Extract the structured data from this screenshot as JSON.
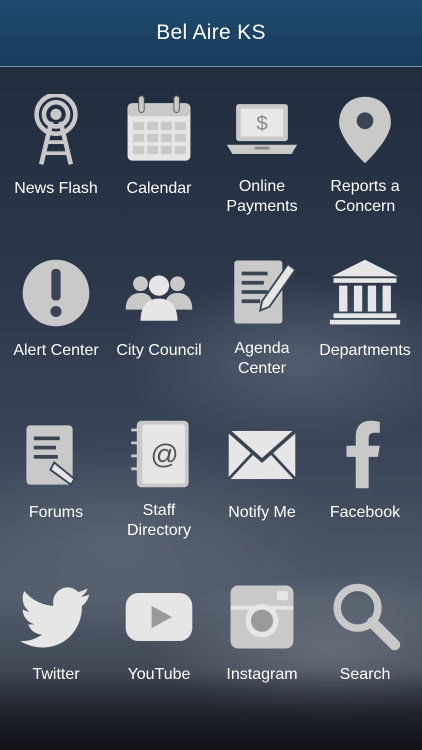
{
  "header": {
    "title": "Bel Aire KS"
  },
  "colors": {
    "icon": "#c9c9c9",
    "header": "#1d466a",
    "label": "#ffffff"
  },
  "tiles": [
    {
      "label": "News Flash",
      "icon": "radio-tower-icon"
    },
    {
      "label": "Calendar",
      "icon": "calendar-icon"
    },
    {
      "label": "Online\nPayments",
      "icon": "laptop-payment-icon"
    },
    {
      "label": "Reports a\nConcern",
      "icon": "map-pin-icon"
    },
    {
      "label": "Alert Center",
      "icon": "alert-icon"
    },
    {
      "label": "City Council",
      "icon": "people-icon"
    },
    {
      "label": "Agenda\nCenter",
      "icon": "agenda-icon"
    },
    {
      "label": "Departments",
      "icon": "building-icon"
    },
    {
      "label": "Forums",
      "icon": "forums-icon"
    },
    {
      "label": "Staff\nDirectory",
      "icon": "address-book-icon"
    },
    {
      "label": "Notify Me",
      "icon": "envelope-icon"
    },
    {
      "label": "Facebook",
      "icon": "facebook-icon"
    },
    {
      "label": "Twitter",
      "icon": "twitter-icon"
    },
    {
      "label": "YouTube",
      "icon": "youtube-icon"
    },
    {
      "label": "Instagram",
      "icon": "instagram-icon"
    },
    {
      "label": "Search",
      "icon": "search-icon"
    }
  ]
}
